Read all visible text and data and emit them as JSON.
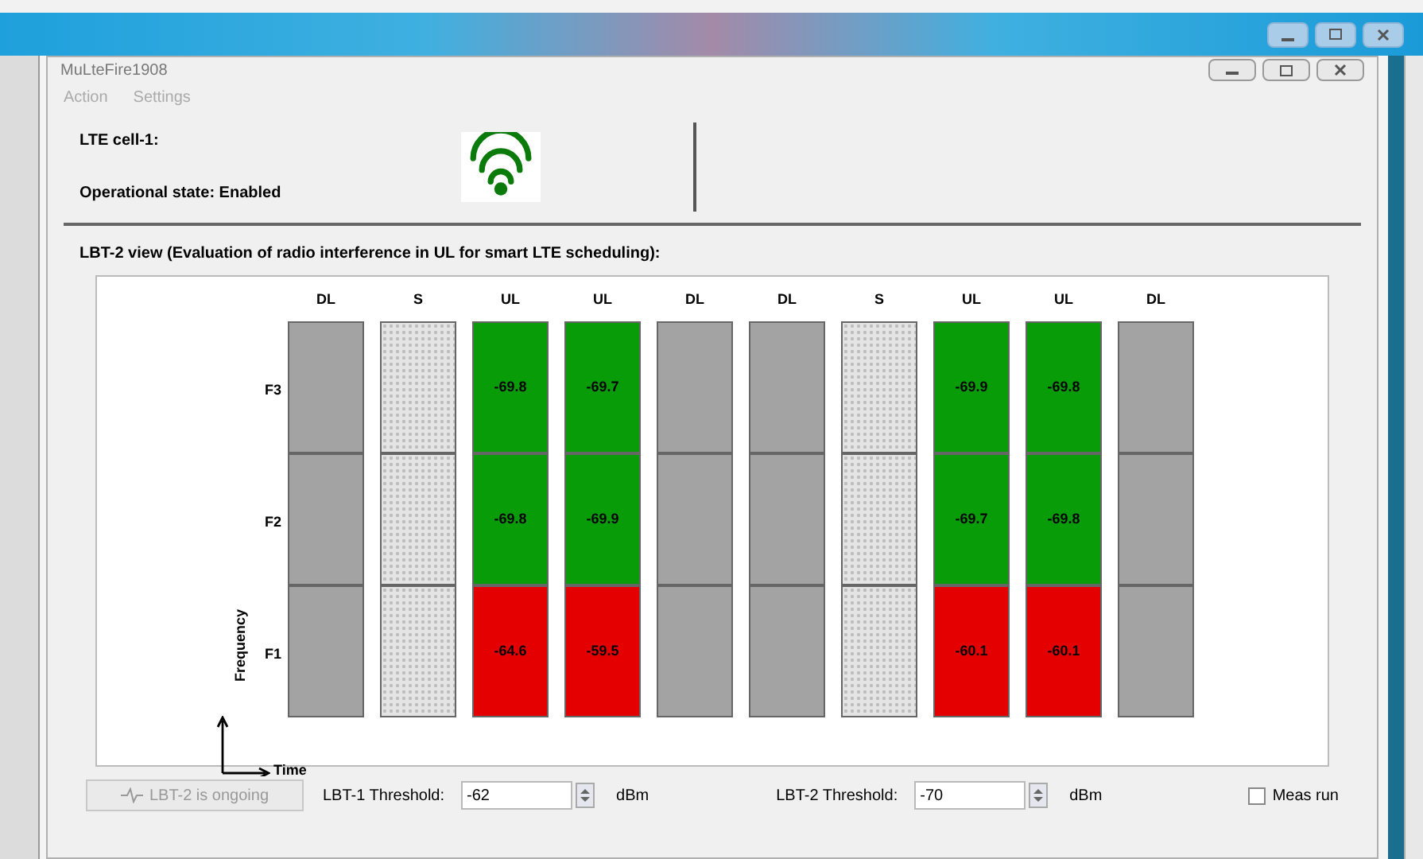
{
  "window": {
    "title": "MuLteFire1908"
  },
  "menu": [
    {
      "label": "Action",
      "disabled": true
    },
    {
      "label": "Settings",
      "disabled": true
    }
  ],
  "cell": {
    "name": "LTE cell-1:",
    "state": "Operational state: Enabled",
    "signal_on": true
  },
  "view": {
    "title": "LBT-2 view (Evaluation of radio interference in UL for smart LTE scheduling):",
    "rows": [
      "F3",
      "F2",
      "F1"
    ],
    "columns": [
      {
        "label": "DL",
        "kind": "dl"
      },
      {
        "label": "S",
        "kind": "s"
      },
      {
        "label": "UL",
        "kind": "ul",
        "cells": [
          {
            "value": "-69.8",
            "color": "#089c08"
          },
          {
            "value": "-69.8",
            "color": "#089c08"
          },
          {
            "value": "-64.6",
            "color": "#e40000"
          }
        ]
      },
      {
        "label": "UL",
        "kind": "ul",
        "cells": [
          {
            "value": "-69.7",
            "color": "#089c08"
          },
          {
            "value": "-69.9",
            "color": "#089c08"
          },
          {
            "value": "-59.5",
            "color": "#e40000"
          }
        ]
      },
      {
        "label": "DL",
        "kind": "dl"
      },
      {
        "label": "DL",
        "kind": "dl"
      },
      {
        "label": "S",
        "kind": "s"
      },
      {
        "label": "UL",
        "kind": "ul",
        "cells": [
          {
            "value": "-69.9",
            "color": "#089c08"
          },
          {
            "value": "-69.7",
            "color": "#089c08"
          },
          {
            "value": "-60.1",
            "color": "#e40000"
          }
        ]
      },
      {
        "label": "UL",
        "kind": "ul",
        "cells": [
          {
            "value": "-69.8",
            "color": "#089c08"
          },
          {
            "value": "-69.8",
            "color": "#089c08"
          },
          {
            "value": "-60.1",
            "color": "#e40000"
          }
        ]
      },
      {
        "label": "DL",
        "kind": "dl"
      }
    ],
    "y_axis": "Frequency",
    "x_axis": "Time"
  },
  "controls": {
    "status_button": {
      "label": "LBT-2 is ongoing",
      "disabled": true
    },
    "lbt1": {
      "label": "LBT-1 Threshold:",
      "value": "-62",
      "unit": "dBm"
    },
    "lbt2": {
      "label": "LBT-2 Threshold:",
      "value": "-70",
      "unit": "dBm"
    },
    "meas_run": {
      "label": "Meas run",
      "checked": false
    }
  }
}
